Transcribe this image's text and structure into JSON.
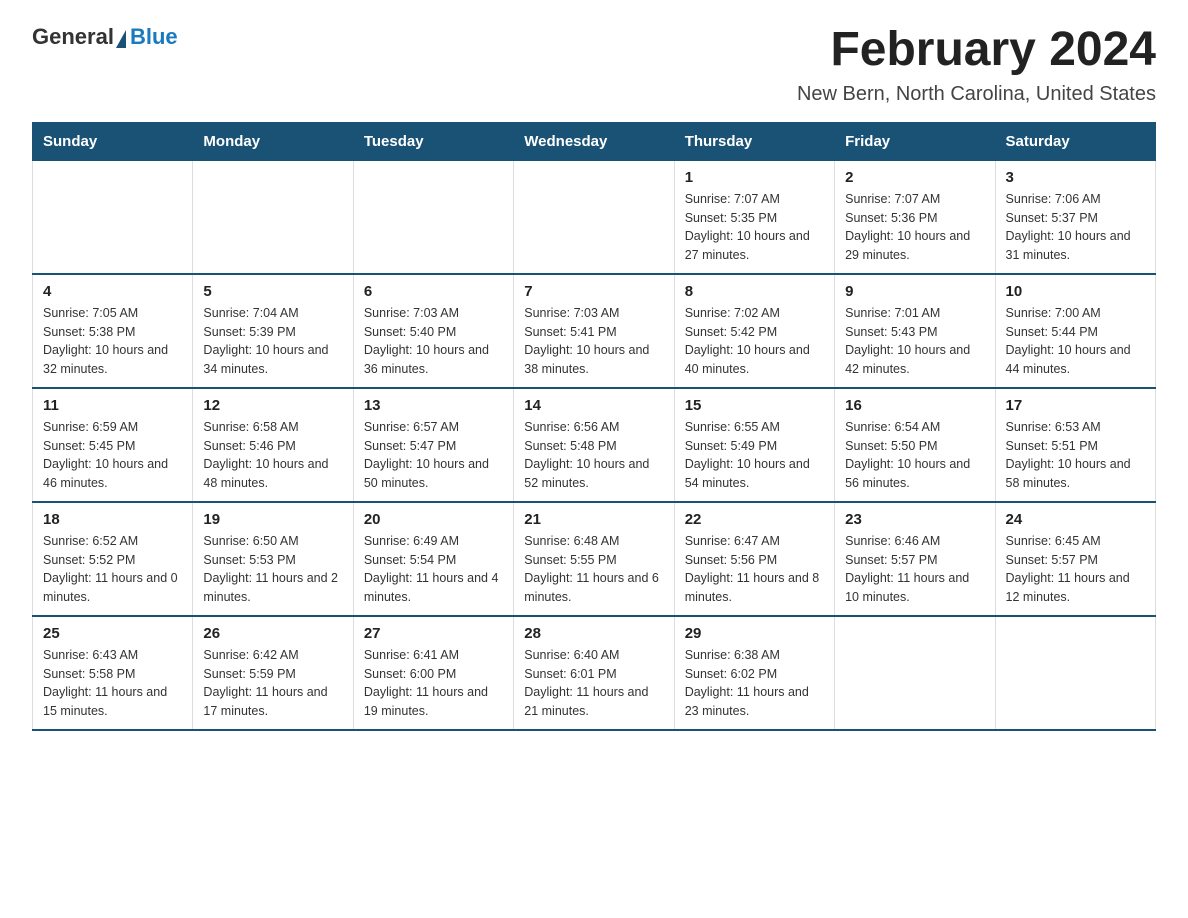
{
  "header": {
    "logo": {
      "general": "General",
      "blue": "Blue"
    },
    "title": "February 2024",
    "location": "New Bern, North Carolina, United States"
  },
  "days_of_week": [
    "Sunday",
    "Monday",
    "Tuesday",
    "Wednesday",
    "Thursday",
    "Friday",
    "Saturday"
  ],
  "weeks": [
    [
      {
        "day": "",
        "info": ""
      },
      {
        "day": "",
        "info": ""
      },
      {
        "day": "",
        "info": ""
      },
      {
        "day": "",
        "info": ""
      },
      {
        "day": "1",
        "info": "Sunrise: 7:07 AM\nSunset: 5:35 PM\nDaylight: 10 hours and 27 minutes."
      },
      {
        "day": "2",
        "info": "Sunrise: 7:07 AM\nSunset: 5:36 PM\nDaylight: 10 hours and 29 minutes."
      },
      {
        "day": "3",
        "info": "Sunrise: 7:06 AM\nSunset: 5:37 PM\nDaylight: 10 hours and 31 minutes."
      }
    ],
    [
      {
        "day": "4",
        "info": "Sunrise: 7:05 AM\nSunset: 5:38 PM\nDaylight: 10 hours and 32 minutes."
      },
      {
        "day": "5",
        "info": "Sunrise: 7:04 AM\nSunset: 5:39 PM\nDaylight: 10 hours and 34 minutes."
      },
      {
        "day": "6",
        "info": "Sunrise: 7:03 AM\nSunset: 5:40 PM\nDaylight: 10 hours and 36 minutes."
      },
      {
        "day": "7",
        "info": "Sunrise: 7:03 AM\nSunset: 5:41 PM\nDaylight: 10 hours and 38 minutes."
      },
      {
        "day": "8",
        "info": "Sunrise: 7:02 AM\nSunset: 5:42 PM\nDaylight: 10 hours and 40 minutes."
      },
      {
        "day": "9",
        "info": "Sunrise: 7:01 AM\nSunset: 5:43 PM\nDaylight: 10 hours and 42 minutes."
      },
      {
        "day": "10",
        "info": "Sunrise: 7:00 AM\nSunset: 5:44 PM\nDaylight: 10 hours and 44 minutes."
      }
    ],
    [
      {
        "day": "11",
        "info": "Sunrise: 6:59 AM\nSunset: 5:45 PM\nDaylight: 10 hours and 46 minutes."
      },
      {
        "day": "12",
        "info": "Sunrise: 6:58 AM\nSunset: 5:46 PM\nDaylight: 10 hours and 48 minutes."
      },
      {
        "day": "13",
        "info": "Sunrise: 6:57 AM\nSunset: 5:47 PM\nDaylight: 10 hours and 50 minutes."
      },
      {
        "day": "14",
        "info": "Sunrise: 6:56 AM\nSunset: 5:48 PM\nDaylight: 10 hours and 52 minutes."
      },
      {
        "day": "15",
        "info": "Sunrise: 6:55 AM\nSunset: 5:49 PM\nDaylight: 10 hours and 54 minutes."
      },
      {
        "day": "16",
        "info": "Sunrise: 6:54 AM\nSunset: 5:50 PM\nDaylight: 10 hours and 56 minutes."
      },
      {
        "day": "17",
        "info": "Sunrise: 6:53 AM\nSunset: 5:51 PM\nDaylight: 10 hours and 58 minutes."
      }
    ],
    [
      {
        "day": "18",
        "info": "Sunrise: 6:52 AM\nSunset: 5:52 PM\nDaylight: 11 hours and 0 minutes."
      },
      {
        "day": "19",
        "info": "Sunrise: 6:50 AM\nSunset: 5:53 PM\nDaylight: 11 hours and 2 minutes."
      },
      {
        "day": "20",
        "info": "Sunrise: 6:49 AM\nSunset: 5:54 PM\nDaylight: 11 hours and 4 minutes."
      },
      {
        "day": "21",
        "info": "Sunrise: 6:48 AM\nSunset: 5:55 PM\nDaylight: 11 hours and 6 minutes."
      },
      {
        "day": "22",
        "info": "Sunrise: 6:47 AM\nSunset: 5:56 PM\nDaylight: 11 hours and 8 minutes."
      },
      {
        "day": "23",
        "info": "Sunrise: 6:46 AM\nSunset: 5:57 PM\nDaylight: 11 hours and 10 minutes."
      },
      {
        "day": "24",
        "info": "Sunrise: 6:45 AM\nSunset: 5:57 PM\nDaylight: 11 hours and 12 minutes."
      }
    ],
    [
      {
        "day": "25",
        "info": "Sunrise: 6:43 AM\nSunset: 5:58 PM\nDaylight: 11 hours and 15 minutes."
      },
      {
        "day": "26",
        "info": "Sunrise: 6:42 AM\nSunset: 5:59 PM\nDaylight: 11 hours and 17 minutes."
      },
      {
        "day": "27",
        "info": "Sunrise: 6:41 AM\nSunset: 6:00 PM\nDaylight: 11 hours and 19 minutes."
      },
      {
        "day": "28",
        "info": "Sunrise: 6:40 AM\nSunset: 6:01 PM\nDaylight: 11 hours and 21 minutes."
      },
      {
        "day": "29",
        "info": "Sunrise: 6:38 AM\nSunset: 6:02 PM\nDaylight: 11 hours and 23 minutes."
      },
      {
        "day": "",
        "info": ""
      },
      {
        "day": "",
        "info": ""
      }
    ]
  ]
}
